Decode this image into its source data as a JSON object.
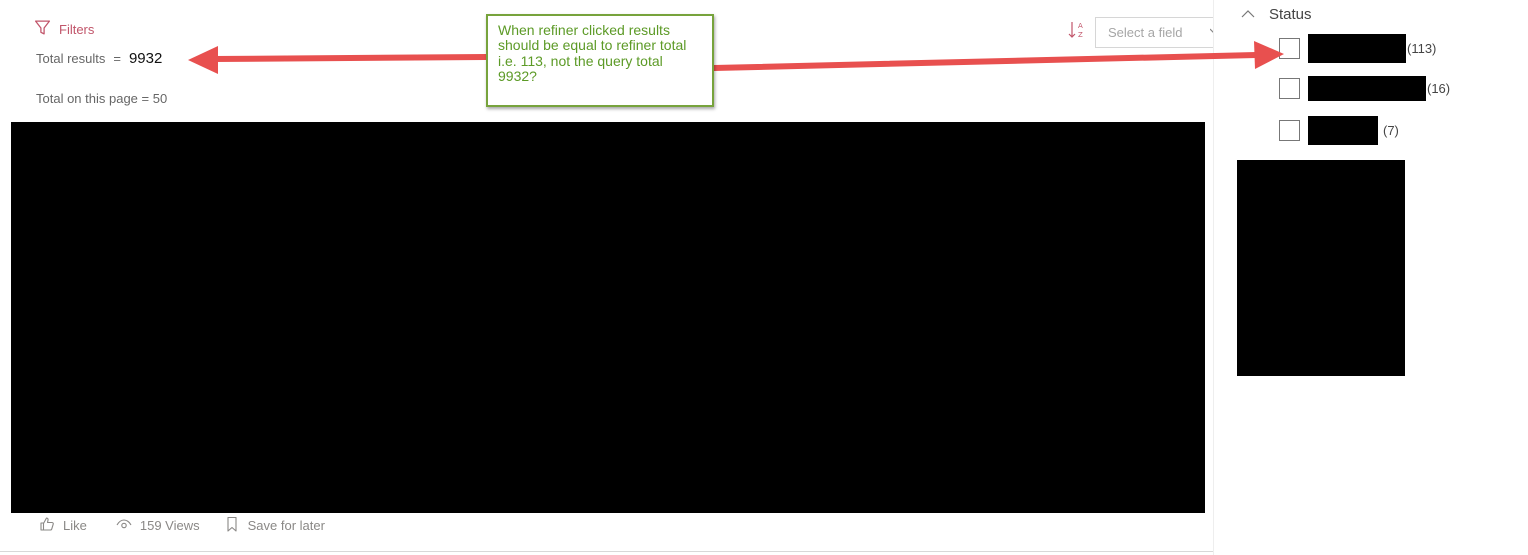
{
  "toolbar": {
    "filters_label": "Filters",
    "sort_icon": "sort-ascending-icon",
    "field_select": {
      "placeholder": "Select a field"
    }
  },
  "results": {
    "total_label": "Total results",
    "equals": "=",
    "total_value": "9932",
    "page_label": "Total ",
    "page_label_rest": "on this page = 50"
  },
  "social": {
    "like_label": "Like",
    "views_label": "159 Views",
    "save_label": "Save for later"
  },
  "refiners": {
    "title": "Status",
    "items": [
      {
        "count": "(113)"
      },
      {
        "count": "(16)"
      },
      {
        "count": "(7)"
      }
    ]
  },
  "annotation": {
    "text": "When refiner clicked results should be equal to refiner total i.e. 113, not the query total 9932?"
  },
  "colors": {
    "accent": "#c1556a",
    "annotation_border": "#77a33c",
    "annotation_text": "#5c9a26",
    "arrow": "#e8504f"
  }
}
